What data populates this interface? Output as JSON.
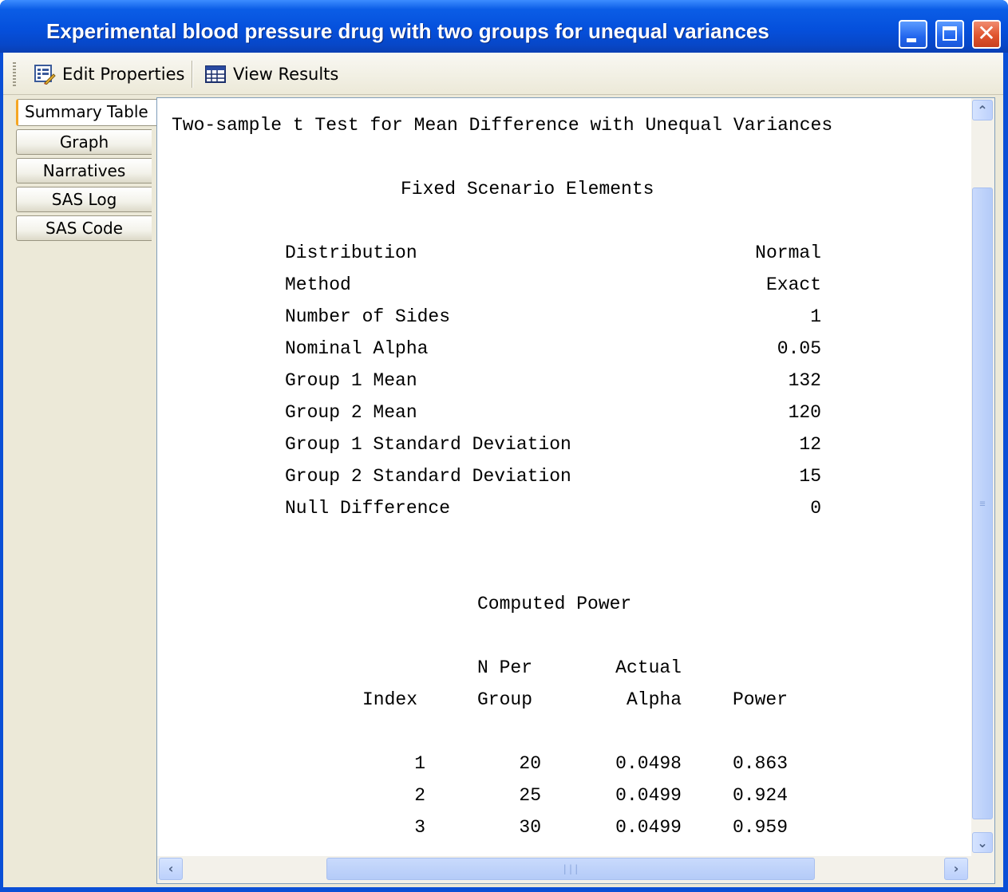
{
  "window": {
    "title": "Experimental blood pressure drug with two groups for unequal variances",
    "controls": {
      "minimize_icon": "minimize-icon",
      "maximize_icon": "maximize-icon",
      "close_icon": "close-icon"
    }
  },
  "toolbar": {
    "edit_properties_label": "Edit Properties",
    "edit_properties_icon": "edit-properties-icon",
    "view_results_label": "View Results",
    "view_results_icon": "view-results-icon"
  },
  "tabs": [
    {
      "label": "Summary Table",
      "active": true
    },
    {
      "label": "Graph",
      "active": false
    },
    {
      "label": "Narratives",
      "active": false
    },
    {
      "label": "SAS Log",
      "active": false
    },
    {
      "label": "SAS Code",
      "active": false
    }
  ],
  "report": {
    "title": "Two-sample t Test for Mean Difference with Unequal Variances",
    "fixed_heading": "Fixed Scenario Elements",
    "fixed_elements": [
      {
        "label": "Distribution",
        "value": "Normal"
      },
      {
        "label": "Method",
        "value": "Exact"
      },
      {
        "label": "Number of Sides",
        "value": "1"
      },
      {
        "label": "Nominal Alpha",
        "value": "0.05"
      },
      {
        "label": "Group 1 Mean",
        "value": "132"
      },
      {
        "label": "Group 2 Mean",
        "value": "120"
      },
      {
        "label": "Group 1 Standard Deviation",
        "value": "12"
      },
      {
        "label": "Group 2 Standard Deviation",
        "value": "15"
      },
      {
        "label": "Null Difference",
        "value": "0"
      }
    ],
    "computed_heading": "Computed Power",
    "columns": {
      "index": "Index",
      "n_top": "N Per",
      "n_bottom": "Group",
      "alpha_top": "Actual",
      "alpha_bottom": "Alpha",
      "power": "Power"
    },
    "rows": [
      {
        "index": "1",
        "n": "20",
        "alpha": "0.0498",
        "power": "0.863"
      },
      {
        "index": "2",
        "n": "25",
        "alpha": "0.0499",
        "power": "0.924"
      },
      {
        "index": "3",
        "n": "30",
        "alpha": "0.0499",
        "power": "0.959"
      }
    ]
  },
  "scrollbars": {
    "up_icon": "scroll-up-icon",
    "down_icon": "scroll-down-icon",
    "left_icon": "scroll-left-icon",
    "right_icon": "scroll-right-icon"
  }
}
